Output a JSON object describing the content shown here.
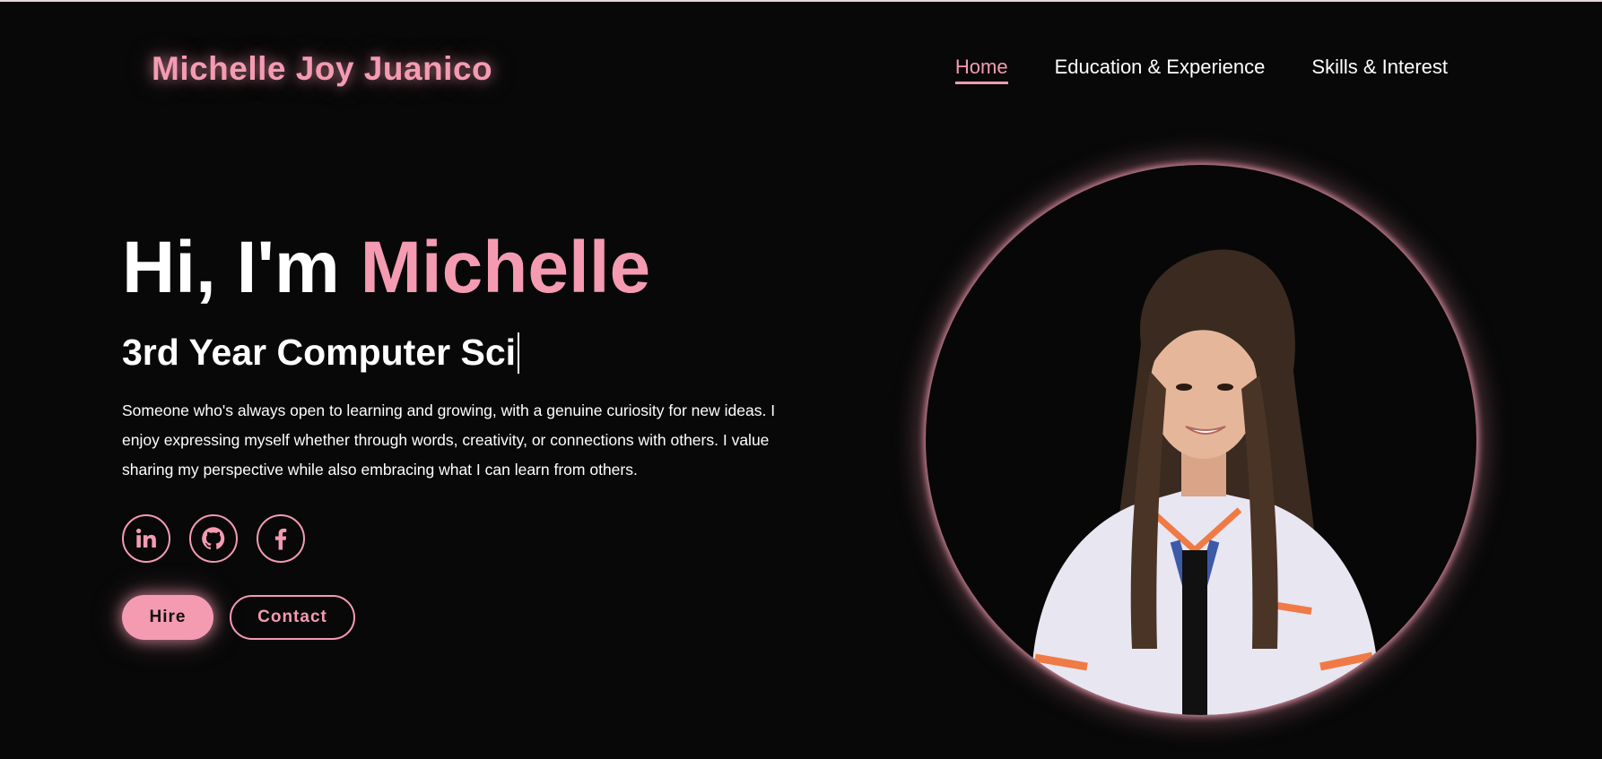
{
  "header": {
    "logo": "Michelle Joy Juanico",
    "nav": [
      {
        "label": "Home",
        "active": true
      },
      {
        "label": "Education & Experience",
        "active": false
      },
      {
        "label": "Skills & Interest",
        "active": false
      }
    ]
  },
  "hero": {
    "greeting": "Hi, I'm",
    "name": "Michelle",
    "typed_subtitle": "3rd Year Computer Sci",
    "description": "Someone who's always open to learning and growing, with a genuine curiosity for new ideas. I enjoy expressing myself whether through words, creativity, or connections with others. I value sharing my perspective while also embracing what I can learn from others.",
    "socials": [
      {
        "icon": "linkedin-icon"
      },
      {
        "icon": "github-icon"
      },
      {
        "icon": "facebook-icon"
      }
    ],
    "buttons": {
      "hire_label": "Hire",
      "contact_label": "Contact"
    }
  },
  "colors": {
    "background": "#080808",
    "accent": "#f49bb2",
    "text": "#ffffff"
  }
}
